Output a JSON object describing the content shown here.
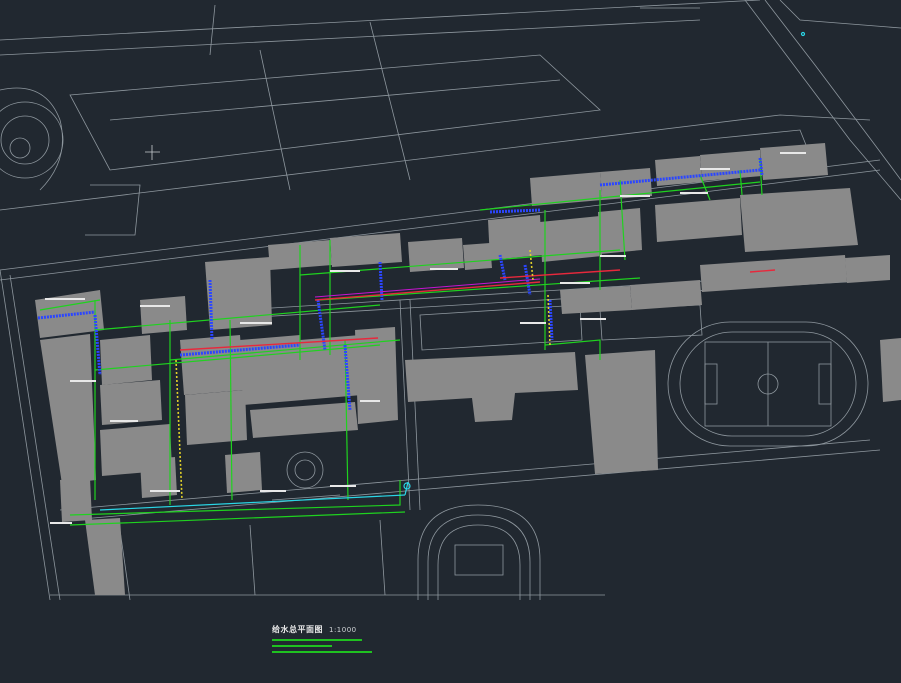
{
  "colors": {
    "background": "#212830",
    "linework": "#8e979e",
    "building": "#8a8a8a",
    "pipe_green": "#1fd21f",
    "pipe_blue": "#2b46ff",
    "pipe_red": "#e8283c",
    "pipe_magenta": "#c814d2",
    "pipe_cyan": "#2ad6e6",
    "pipe_yellow": "#e2d22a",
    "text": "#e8e8e8"
  },
  "drawing": {
    "title": "给水总平面图",
    "scale": "1:1000"
  }
}
